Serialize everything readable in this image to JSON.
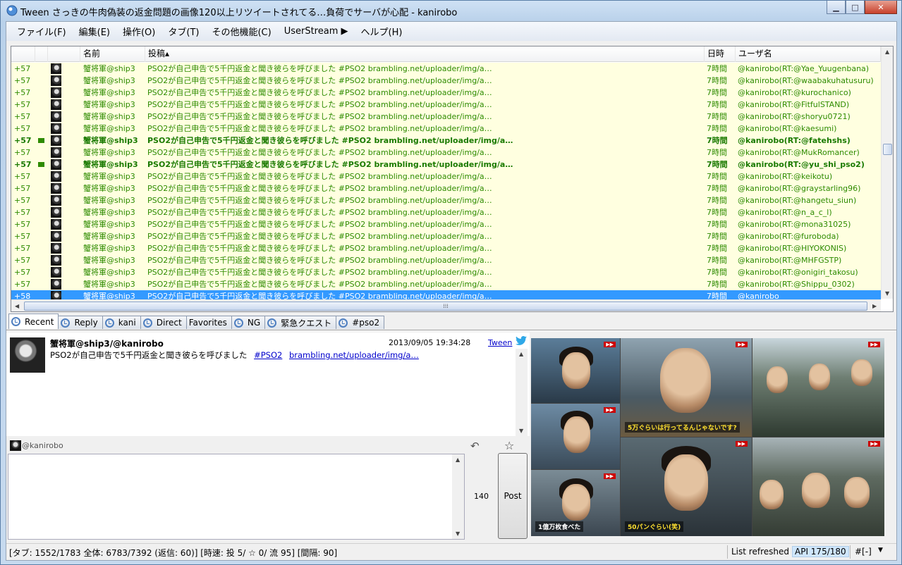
{
  "window": {
    "title": "Tween  さっきの牛肉偽装の返金問題の画像120以上リツイートされてる…負荷でサーバが心配 - kanirobo",
    "controls": {
      "minimize": "▁",
      "maximize": "□",
      "close": "✕"
    }
  },
  "menu": [
    "ファイル(F)",
    "編集(E)",
    "操作(O)",
    "タブ(T)",
    "その他機能(C)",
    "UserStream ▶",
    "ヘルプ(H)"
  ],
  "list": {
    "headers": {
      "name": "名前",
      "post": "投稿▴",
      "time": "日時",
      "user": "ユーザ名"
    },
    "rows": [
      {
        "num": "+57",
        "mark": false,
        "name": "蟹将軍@ship3",
        "post": "PSO2が自己申告で5千円返金と聞き彼らを呼びました #PSO2  brambling.net/uploader/img/a…",
        "time": "7時間",
        "user": "@kanirobo(RT:@Yae_Yuugenbana)",
        "style": "normal"
      },
      {
        "num": "+57",
        "mark": false,
        "name": "蟹将軍@ship3",
        "post": "PSO2が自己申告で5千円返金と聞き彼らを呼びました #PSO2  brambling.net/uploader/img/a…",
        "time": "7時間",
        "user": "@kanirobo(RT:@waabakuhatusuru)",
        "style": "normal"
      },
      {
        "num": "+57",
        "mark": false,
        "name": "蟹将軍@ship3",
        "post": "PSO2が自己申告で5千円返金と聞き彼らを呼びました #PSO2  brambling.net/uploader/img/a…",
        "time": "7時間",
        "user": "@kanirobo(RT:@kurochanico)",
        "style": "normal"
      },
      {
        "num": "+57",
        "mark": false,
        "name": "蟹将軍@ship3",
        "post": "PSO2が自己申告で5千円返金と聞き彼らを呼びました #PSO2  brambling.net/uploader/img/a…",
        "time": "7時間",
        "user": "@kanirobo(RT:@FitfulSTAND)",
        "style": "normal"
      },
      {
        "num": "+57",
        "mark": false,
        "name": "蟹将軍@ship3",
        "post": "PSO2が自己申告で5千円返金と聞き彼らを呼びました #PSO2  brambling.net/uploader/img/a…",
        "time": "7時間",
        "user": "@kanirobo(RT:@shoryu0721)",
        "style": "normal"
      },
      {
        "num": "+57",
        "mark": false,
        "name": "蟹将軍@ship3",
        "post": "PSO2が自己申告で5千円返金と聞き彼らを呼びました #PSO2  brambling.net/uploader/img/a…",
        "time": "7時間",
        "user": "@kanirobo(RT:@kaesumi)",
        "style": "normal"
      },
      {
        "num": "+57",
        "mark": true,
        "name": "蟹将軍@ship3",
        "post": "PSO2が自己申告で5千円返金と聞き彼らを呼びました #PSO2  brambling.net/uploader/img/a…",
        "time": "7時間",
        "user": "@kanirobo(RT:@fatehshs)",
        "style": "bold"
      },
      {
        "num": "+57",
        "mark": false,
        "name": "蟹将軍@ship3",
        "post": "PSO2が自己申告で5千円返金と聞き彼らを呼びました #PSO2  brambling.net/uploader/img/a…",
        "time": "7時間",
        "user": "@kanirobo(RT:@MukRomancer)",
        "style": "normal"
      },
      {
        "num": "+57",
        "mark": true,
        "name": "蟹将軍@ship3",
        "post": "PSO2が自己申告で5千円返金と聞き彼らを呼びました #PSO2  brambling.net/uploader/img/a…",
        "time": "7時間",
        "user": "@kanirobo(RT:@yu_shi_pso2)",
        "style": "bold"
      },
      {
        "num": "+57",
        "mark": false,
        "name": "蟹将軍@ship3",
        "post": "PSO2が自己申告で5千円返金と聞き彼らを呼びました #PSO2  brambling.net/uploader/img/a…",
        "time": "7時間",
        "user": "@kanirobo(RT:@keikotu)",
        "style": "normal"
      },
      {
        "num": "+57",
        "mark": false,
        "name": "蟹将軍@ship3",
        "post": "PSO2が自己申告で5千円返金と聞き彼らを呼びました #PSO2  brambling.net/uploader/img/a…",
        "time": "7時間",
        "user": "@kanirobo(RT:@graystarling96)",
        "style": "normal"
      },
      {
        "num": "+57",
        "mark": false,
        "name": "蟹将軍@ship3",
        "post": "PSO2が自己申告で5千円返金と聞き彼らを呼びました #PSO2  brambling.net/uploader/img/a…",
        "time": "7時間",
        "user": "@kanirobo(RT:@hangetu_siun)",
        "style": "normal"
      },
      {
        "num": "+57",
        "mark": false,
        "name": "蟹将軍@ship3",
        "post": "PSO2が自己申告で5千円返金と聞き彼らを呼びました #PSO2  brambling.net/uploader/img/a…",
        "time": "7時間",
        "user": "@kanirobo(RT:@n_a_c_l)",
        "style": "normal"
      },
      {
        "num": "+57",
        "mark": false,
        "name": "蟹将軍@ship3",
        "post": "PSO2が自己申告で5千円返金と聞き彼らを呼びました #PSO2  brambling.net/uploader/img/a…",
        "time": "7時間",
        "user": "@kanirobo(RT:@mona31025)",
        "style": "normal"
      },
      {
        "num": "+57",
        "mark": false,
        "name": "蟹将軍@ship3",
        "post": "PSO2が自己申告で5千円返金と聞き彼らを呼びました #PSO2  brambling.net/uploader/img/a…",
        "time": "7時間",
        "user": "@kanirobo(RT:@furoboda)",
        "style": "normal"
      },
      {
        "num": "+57",
        "mark": false,
        "name": "蟹将軍@ship3",
        "post": "PSO2が自己申告で5千円返金と聞き彼らを呼びました #PSO2  brambling.net/uploader/img/a…",
        "time": "7時間",
        "user": "@kanirobo(RT:@HIYOKONIS)",
        "style": "normal"
      },
      {
        "num": "+57",
        "mark": false,
        "name": "蟹将軍@ship3",
        "post": "PSO2が自己申告で5千円返金と聞き彼らを呼びました #PSO2  brambling.net/uploader/img/a…",
        "time": "7時間",
        "user": "@kanirobo(RT:@MHFGSTP)",
        "style": "normal"
      },
      {
        "num": "+57",
        "mark": false,
        "name": "蟹将軍@ship3",
        "post": "PSO2が自己申告で5千円返金と聞き彼らを呼びました #PSO2  brambling.net/uploader/img/a…",
        "time": "7時間",
        "user": "@kanirobo(RT:@onigiri_takosu)",
        "style": "normal"
      },
      {
        "num": "+57",
        "mark": false,
        "name": "蟹将軍@ship3",
        "post": "PSO2が自己申告で5千円返金と聞き彼らを呼びました #PSO2  brambling.net/uploader/img/a…",
        "time": "7時間",
        "user": "@kanirobo(RT:@Shippu_0302)",
        "style": "normal"
      },
      {
        "num": "+58",
        "mark": false,
        "name": "蟹将軍@ship3",
        "post": "PSO2が自己申告で5千円返金と聞き彼らを呼びました #PSO2  brambling.net/uploader/img/a…",
        "time": "7時間",
        "user": "@kanirobo",
        "style": "sel"
      }
    ]
  },
  "tabs": [
    "Recent",
    "Reply",
    "kani",
    "Direct",
    "Favorites",
    "NG",
    "緊急クエスト",
    "#pso2"
  ],
  "detail": {
    "name": "蟹将軍@ship3/@kanirobo",
    "date": "2013/09/05 19:34:28",
    "via": "Tween",
    "text": "PSO2が自己申告で5千円返金と聞き彼らを呼びました",
    "hashtag": "#PSO2",
    "link": "brambling.net/uploader/img/a…"
  },
  "compose": {
    "reply_user": "@kanirobo",
    "counter": "140",
    "post_label": "Post",
    "text": ""
  },
  "preview": {
    "captions": [
      "5万ぐらいは行ってるんじゃないです?",
      "50パンぐらい(笑)",
      "1億万枚食べた"
    ]
  },
  "status": {
    "main": "[タブ: 1552/1783 全体: 6783/7392 (返信: 60)] [時速: 投 5/ ☆ 0/ 流 95] [間隔: 90]",
    "list": "List refreshed",
    "api": "API 175/180",
    "hash": "#[-]"
  },
  "colors": {
    "row_bg": "#ffffe0",
    "row_text": "#2e8b00",
    "selected": "#3399ff",
    "link": "#0000cc"
  }
}
